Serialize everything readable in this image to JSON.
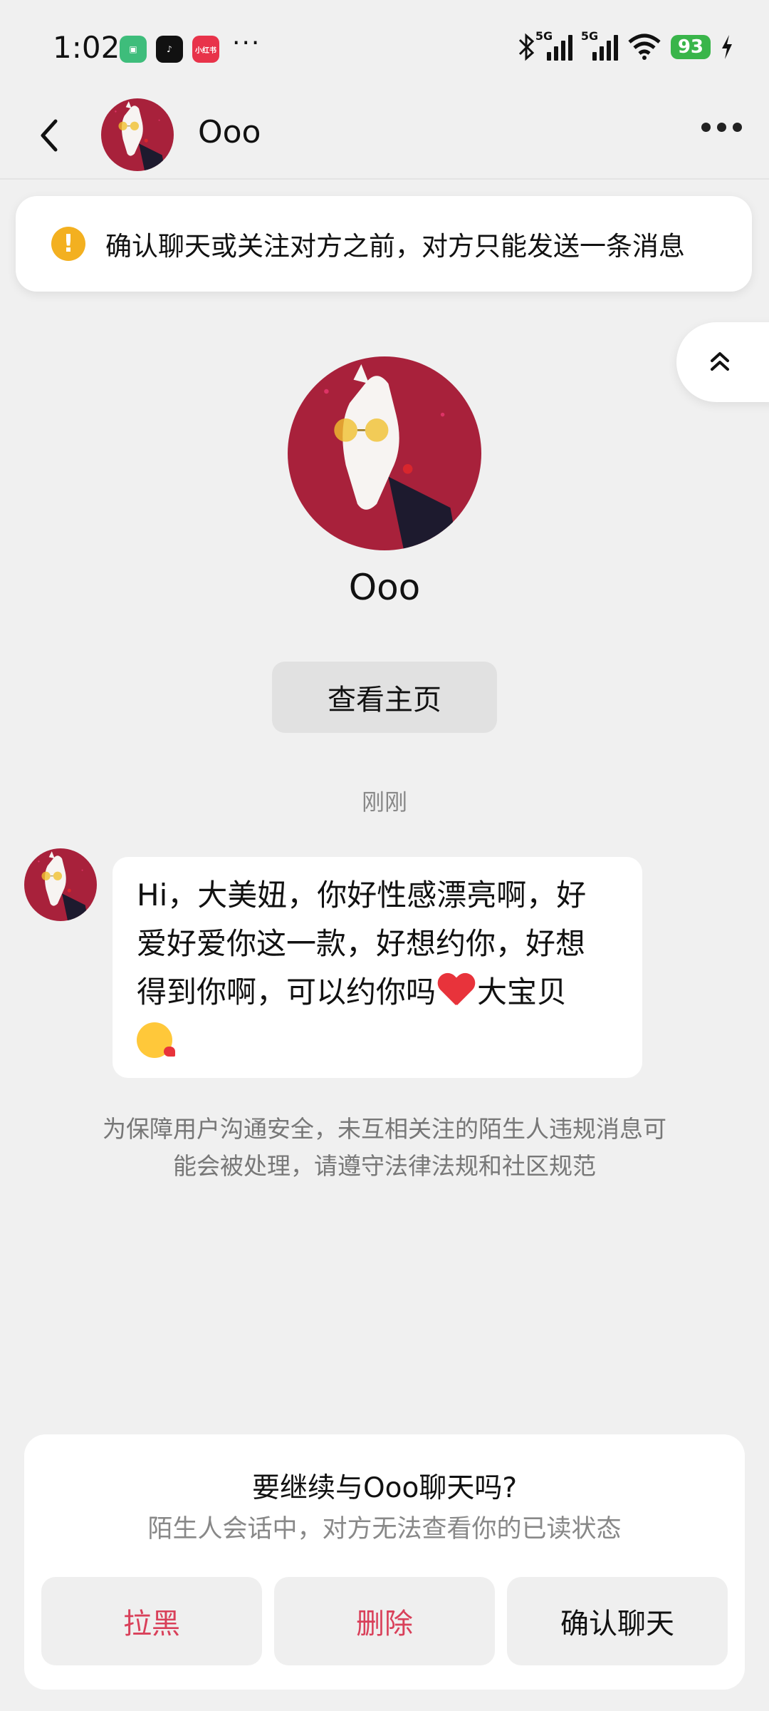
{
  "status_bar": {
    "time": "1:02",
    "battery": "93",
    "network_1": "5G",
    "network_2": "5G",
    "more_apps": "···",
    "app_icon_3_text": "小红书"
  },
  "header": {
    "name": "Ooo"
  },
  "notice": {
    "text": "确认聊天或关注对方之前，对方只能发送一条消息"
  },
  "profile": {
    "name": "Ooo",
    "view_profile_label": "查看主页"
  },
  "timestamp": "刚刚",
  "message": {
    "line1": "Hi，大美妞，你好性感漂亮啊，好",
    "line2": "爱好爱你这一款，好想约你，好想",
    "line3_before": "得到你啊，可以约你吗",
    "line3_after": "大宝贝"
  },
  "safety_note": "为保障用户沟通安全，未互相关注的陌生人违规消息可能会被处理，请遵守法律法规和社区规范",
  "bottom_panel": {
    "title": "要继续与Ooo聊天吗?",
    "subtitle": "陌生人会话中，对方无法查看你的已读状态",
    "block_label": "拉黑",
    "delete_label": "删除",
    "confirm_label": "确认聊天"
  },
  "colors": {
    "accent_red": "#d9405a",
    "warning": "#f3b020",
    "battery_green": "#39b54a",
    "avatar_bg": "#a8213b"
  },
  "icons": [
    "back-icon",
    "more-icon",
    "warning-icon",
    "scroll-top-icon",
    "heart-emoji",
    "kiss-emoji",
    "bluetooth-icon",
    "signal-icon",
    "wifi-icon",
    "battery-icon",
    "charging-icon"
  ]
}
